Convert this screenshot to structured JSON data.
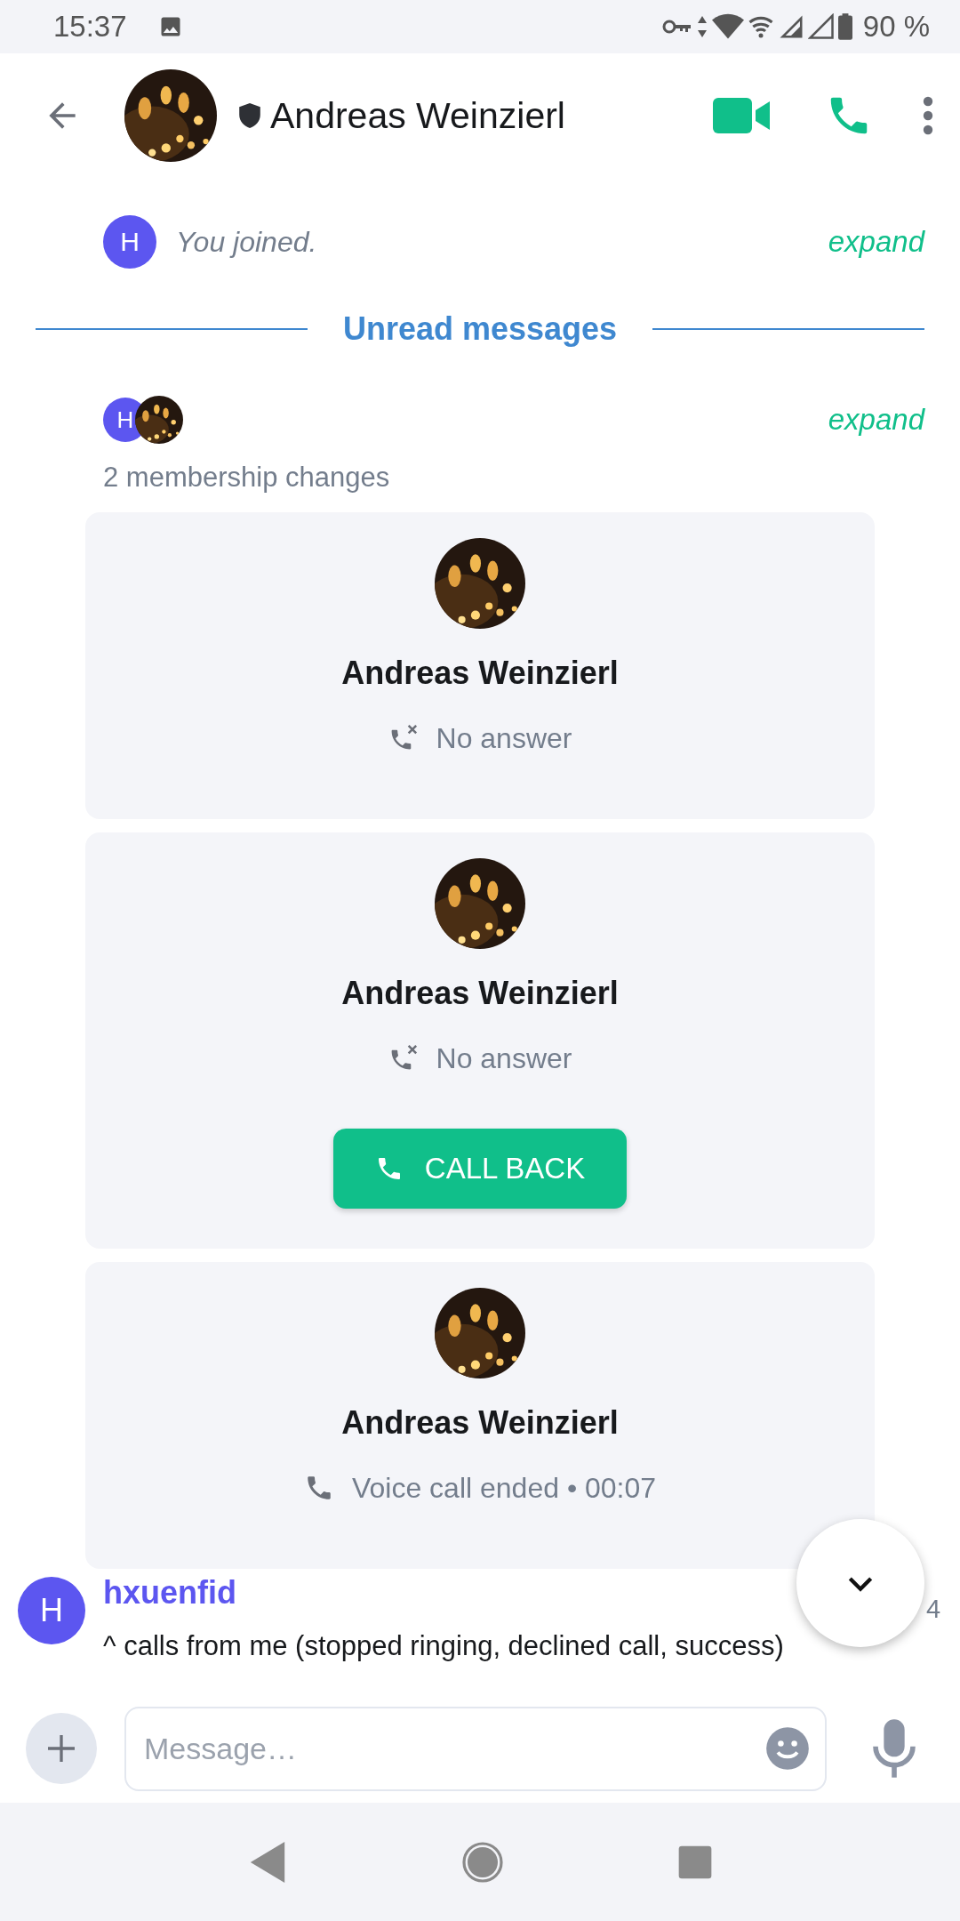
{
  "status_bar": {
    "time": "15:37",
    "battery": "90 %"
  },
  "header": {
    "title": "Andreas Weinzierl",
    "verified": true
  },
  "timeline": [
    {
      "kind": "event",
      "avatar_letter": "H",
      "text": "You joined.",
      "action": "expand"
    },
    {
      "kind": "divider",
      "text": "Unread messages"
    },
    {
      "kind": "membership",
      "avatar_letter": "H",
      "text": "2 membership changes",
      "action": "expand"
    },
    {
      "kind": "call",
      "name": "Andreas Weinzierl",
      "missed": true,
      "status": "No answer"
    },
    {
      "kind": "call",
      "name": "Andreas Weinzierl",
      "missed": true,
      "status": "No answer",
      "button": "CALL BACK"
    },
    {
      "kind": "call",
      "name": "Andreas Weinzierl",
      "missed": false,
      "status": "Voice call ended • 00:07"
    },
    {
      "kind": "message",
      "avatar_letter": "H",
      "sender": "hxuenfid",
      "time": "4",
      "text": "^ calls from me (stopped ringing, declined call, success)"
    }
  ],
  "composer": {
    "placeholder": "Message…"
  }
}
